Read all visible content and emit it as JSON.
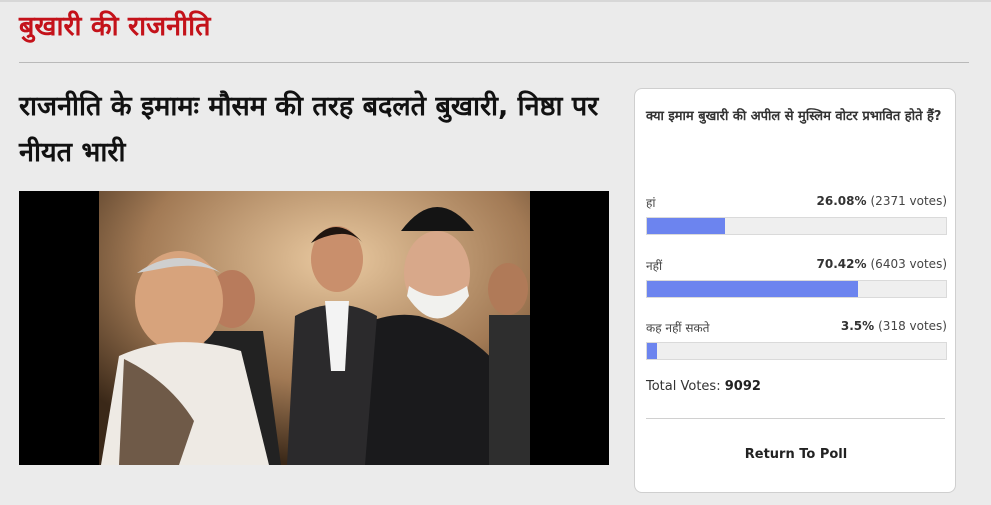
{
  "section": {
    "title": "बुखारी की राजनीति"
  },
  "article": {
    "headline": "राजनीति के इमामः मौसम की तरह बदलते बुखारी, निष्ठा पर नीयत भारी"
  },
  "poll": {
    "question": "क्या इमाम बुखारी की अपील से मुस्लिम वोटर प्रभावित होते हैं?",
    "options": [
      {
        "label": "हां",
        "percent_text": "26.08%",
        "votes_text": "(2371 votes)",
        "percent": 26.08
      },
      {
        "label": "नहीं",
        "percent_text": "70.42%",
        "votes_text": "(6403 votes)",
        "percent": 70.42
      },
      {
        "label": "कह नहीं सकते",
        "percent_text": "3.5%",
        "votes_text": "(318 votes)",
        "percent": 3.5
      }
    ],
    "total_label": "Total Votes:",
    "total_value": "9092",
    "return_label": "Return To Poll",
    "bar_color": "#6c84ef"
  },
  "colors": {
    "section_title": "#c4121a",
    "page_bg": "#ebebeb"
  }
}
